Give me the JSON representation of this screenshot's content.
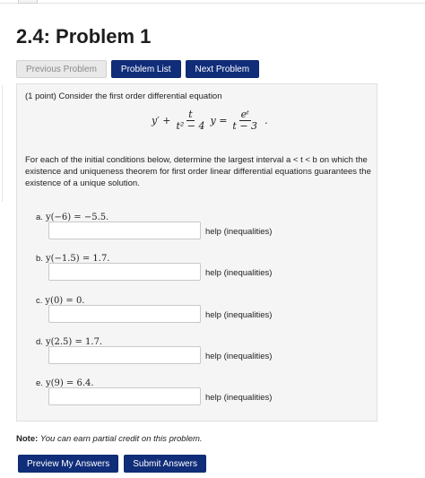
{
  "page": {
    "title": "2.4: Problem 1"
  },
  "nav": {
    "previous_label": "Previous Problem",
    "list_label": "Problem List",
    "next_label": "Next Problem"
  },
  "problem": {
    "intro": "(1 point) Consider the first order differential equation",
    "equation": {
      "lhs_start": "y′ +",
      "frac1_num": "t",
      "frac1_den": "t² − 4",
      "middle": "y =",
      "frac2_num": "eᵗ",
      "frac2_den": "t − 3",
      "end": "."
    },
    "description": "For each of the initial conditions below, determine the largest interval a < t < b on which the existence and uniqueness theorem for first order linear differential equations guarantees the existence of a unique solution.",
    "items": [
      {
        "letter": "a.",
        "condition": "y(−6) = −5.5.",
        "value": "",
        "help": "help (inequalities)"
      },
      {
        "letter": "b.",
        "condition": "y(−1.5) = 1.7.",
        "value": "",
        "help": "help (inequalities)"
      },
      {
        "letter": "c.",
        "condition": "y(0) = 0.",
        "value": "",
        "help": "help (inequalities)"
      },
      {
        "letter": "d.",
        "condition": "y(2.5) = 1.7.",
        "value": "",
        "help": "help (inequalities)"
      },
      {
        "letter": "e.",
        "condition": "y(9) = 6.4.",
        "value": "",
        "help": "help (inequalities)"
      }
    ]
  },
  "note": {
    "label": "Note:",
    "text": "You can earn partial credit on this problem."
  },
  "actions": {
    "preview_label": "Preview My Answers",
    "submit_label": "Submit Answers"
  },
  "colors": {
    "button_primary": "#102d7a",
    "button_disabled": "#e9e9e9",
    "panel_bg": "#f5f5f5"
  }
}
